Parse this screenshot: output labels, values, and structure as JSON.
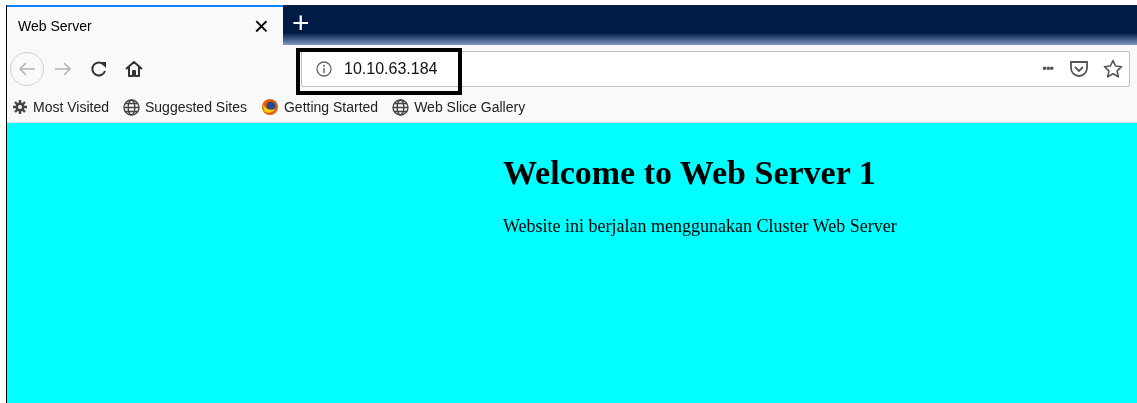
{
  "tabs": [
    {
      "title": "Web Server",
      "close": "×",
      "selected": true
    }
  ],
  "new_tab": "+",
  "address_bar": {
    "value": "10.10.63.184",
    "menu": "•••"
  },
  "bookmarks": [
    {
      "label": "Most Visited",
      "kind": "settings"
    },
    {
      "label": "Suggested Sites",
      "kind": "web"
    },
    {
      "label": "Getting Started",
      "kind": "browser"
    },
    {
      "label": "Web Slice Gallery",
      "kind": "web"
    }
  ],
  "page": {
    "heading": "Welcome to Web Server 1",
    "text": "Website ini berjalan menggunakan Cluster Web Server"
  }
}
